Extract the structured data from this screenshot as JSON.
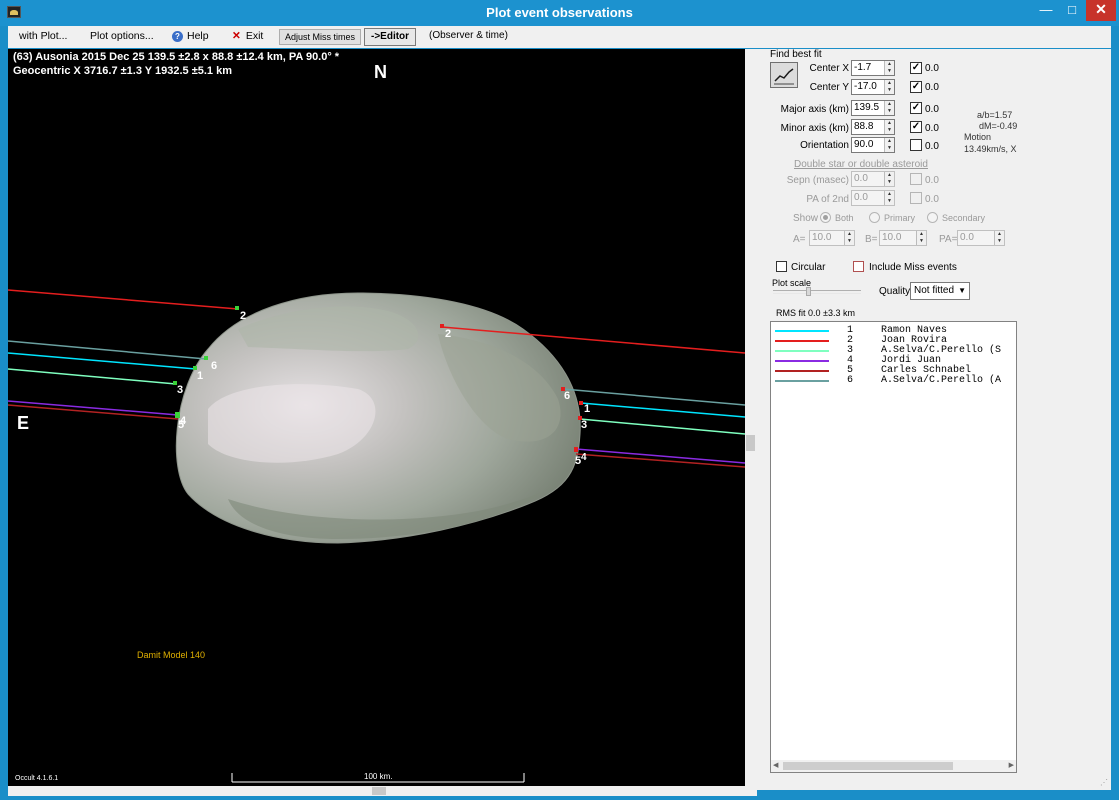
{
  "window": {
    "title": "Plot event observations",
    "minimize": "—",
    "maximize": "□",
    "close": "✕"
  },
  "toolbar": {
    "with_plot": "with Plot...",
    "plot_options": "Plot options...",
    "help": "Help",
    "exit": "Exit",
    "adjust_miss": "Adjust Miss times",
    "editor": "->Editor",
    "observer_time": "(Observer & time)"
  },
  "plot": {
    "header_line1": "(63) Ausonia  2015 Dec 25   139.5 ±2.8 x 88.8 ±12.4 km, PA 90.0° *",
    "header_line2": "Geocentric  X  3716.7 ±1.3  Y  1932.5 ±5.1 km",
    "north": "N",
    "east": "E",
    "model_label": "Damit Model 140",
    "version": "Occult 4.1.6.1",
    "scale_label": "100 km.",
    "chord_labels": [
      "1",
      "2",
      "3",
      "4",
      "5",
      "6"
    ]
  },
  "panel": {
    "find_best_fit": "Find best fit",
    "center_x": {
      "label": "Center X",
      "value": "-1.7",
      "checked": true,
      "uncert": "0.0"
    },
    "center_y": {
      "label": "Center Y",
      "value": "-17.0",
      "checked": true,
      "uncert": "0.0"
    },
    "major_axis": {
      "label": "Major axis (km)",
      "value": "139.5",
      "checked": true,
      "uncert": "0.0"
    },
    "minor_axis": {
      "label": "Minor axis (km)",
      "value": "88.8",
      "checked": true,
      "uncert": "0.0"
    },
    "orientation": {
      "label": "Orientation",
      "value": "90.0",
      "checked": false,
      "uncert": "0.0"
    },
    "info": {
      "ab": "a/b=1.57",
      "dm": "dM=-0.49",
      "motion_label": "Motion",
      "motion_value": "13.49km/s, X"
    },
    "double_header": "Double star  or  double asteroid",
    "sepn": {
      "label": "Sepn (masec)",
      "value": "0.0",
      "uncert": "0.0"
    },
    "pa2nd": {
      "label": "PA of 2nd",
      "value": "0.0",
      "uncert": "0.0"
    },
    "show_label": "Show",
    "show_options": [
      "Both",
      "Primary",
      "Secondary"
    ],
    "a_label": "A=",
    "a_value": "10.0",
    "b_label": "B=",
    "b_value": "10.0",
    "pa_label": "PA=",
    "pa_value": "0.0",
    "circular": "Circular",
    "include_miss": "Include Miss events",
    "plot_scale": "Plot scale",
    "quality_label": "Quality",
    "quality_value": "Not fitted",
    "rms_fit": "RMS fit 0.0 ±3.3 km"
  },
  "legend": [
    {
      "num": "1",
      "name": "Ramon Naves",
      "color": "#00e5ff"
    },
    {
      "num": "2",
      "name": "Joan Rovira",
      "color": "#e41e1e"
    },
    {
      "num": "3",
      "name": "A.Selva/C.Perello (S",
      "color": "#7fffbf"
    },
    {
      "num": "4",
      "name": "Jordi Juan",
      "color": "#8a2be2"
    },
    {
      "num": "5",
      "name": "Carles Schnabel",
      "color": "#b22222"
    },
    {
      "num": "6",
      "name": "A.Selva/C.Perello (A",
      "color": "#6aa0a0"
    }
  ],
  "colors": {
    "titlebar": "#1c92cf",
    "plot_bg": "#000000",
    "asteroid": "#9aa598",
    "close": "#c7332a",
    "model_label": "#e0b000"
  }
}
